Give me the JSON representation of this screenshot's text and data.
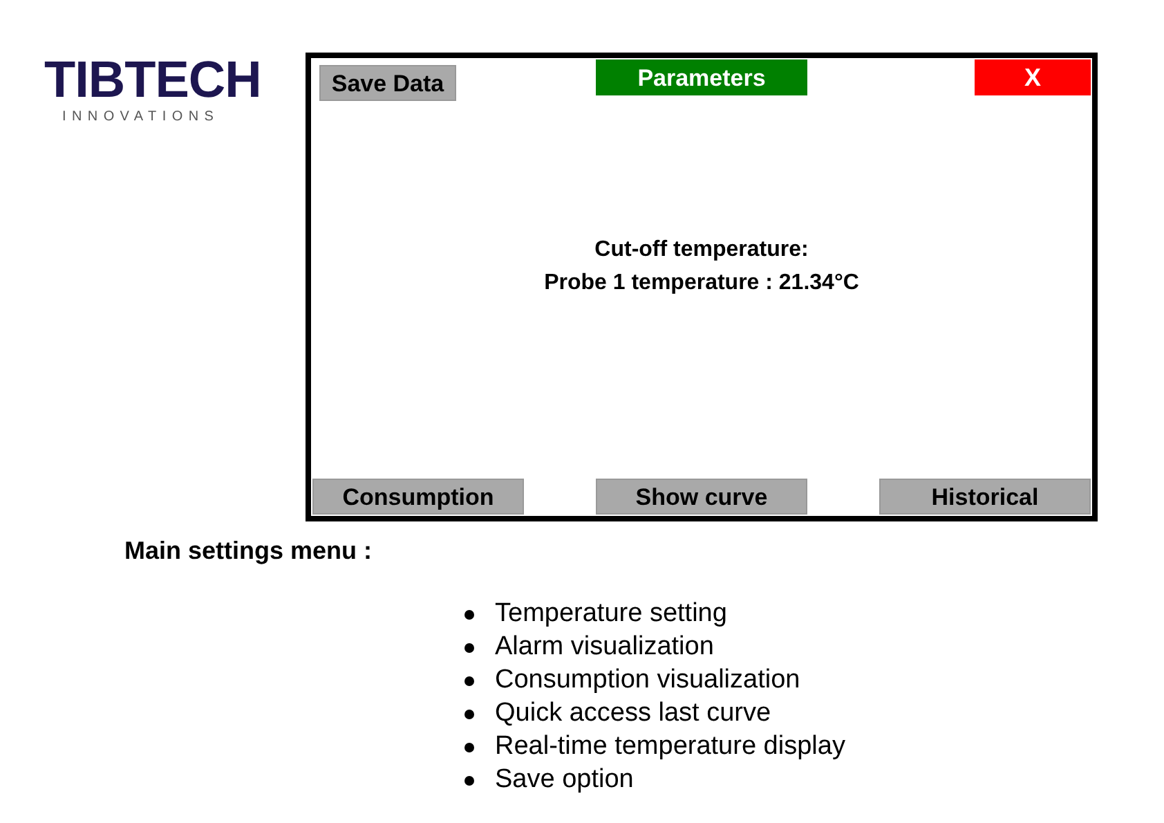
{
  "logo": {
    "name": "TIBTECH",
    "tagline": "INNOVATIONS"
  },
  "screen": {
    "top_buttons": [
      {
        "label": "Save Data",
        "kind": "action"
      },
      {
        "label": "Parameters",
        "kind": "title"
      },
      {
        "label": "X",
        "kind": "close"
      }
    ],
    "lines": [
      "Cut-off temperature:",
      "Probe 1 temperature : 21.34°C"
    ],
    "bottom_buttons": [
      "Consumption",
      "Show curve",
      "Historical"
    ]
  },
  "heading": "Main settings menu :",
  "features": [
    "Temperature setting",
    "Alarm visualization",
    "Consumption visualization",
    "Quick access last curve",
    "Real-time temperature display",
    "Save option"
  ]
}
